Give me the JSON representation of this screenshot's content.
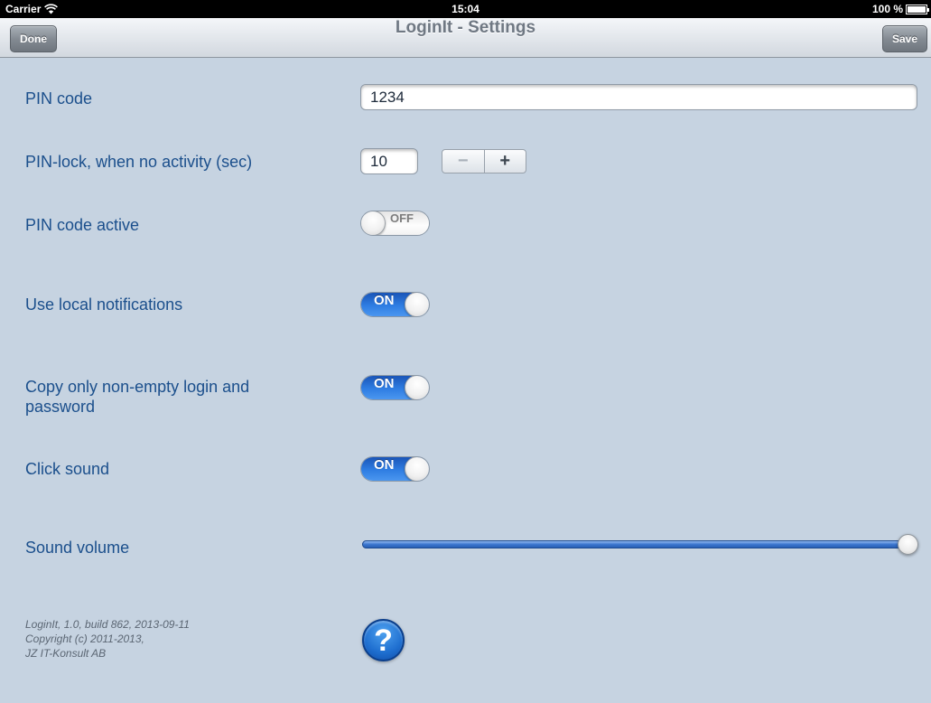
{
  "status_bar": {
    "carrier": "Carrier",
    "time": "15:04",
    "battery": "100 %",
    "wifi_icon": "wifi-icon",
    "battery_icon": "battery-icon"
  },
  "nav": {
    "title": "LoginIt - Settings",
    "done_label": "Done",
    "save_label": "Save"
  },
  "settings": {
    "pin_code": {
      "label": "PIN code",
      "value": "1234"
    },
    "pin_lock": {
      "label": "PIN-lock, when no activity (sec)",
      "value": "10",
      "minus": "−",
      "plus": "+"
    },
    "pin_active": {
      "label": "PIN code active",
      "state": "OFF"
    },
    "local_notifications": {
      "label": "Use local notifications",
      "state": "ON"
    },
    "copy_non_empty": {
      "label": "Copy only non-empty login and password",
      "state": "ON"
    },
    "click_sound": {
      "label": "Click sound",
      "state": "ON"
    },
    "sound_volume": {
      "label": "Sound volume",
      "level": 1.0
    }
  },
  "footer": {
    "line1": "LoginIt, 1.0, build 862, 2013-09-11",
    "line2": "Copyright (c) 2011-2013,",
    "line3": "JZ IT-Konsult AB"
  },
  "help": {
    "glyph": "?",
    "icon": "help-icon"
  },
  "colors": {
    "background": "#c6d3e1",
    "label": "#1b4f8c",
    "switch_on": "#2f7ee3"
  }
}
